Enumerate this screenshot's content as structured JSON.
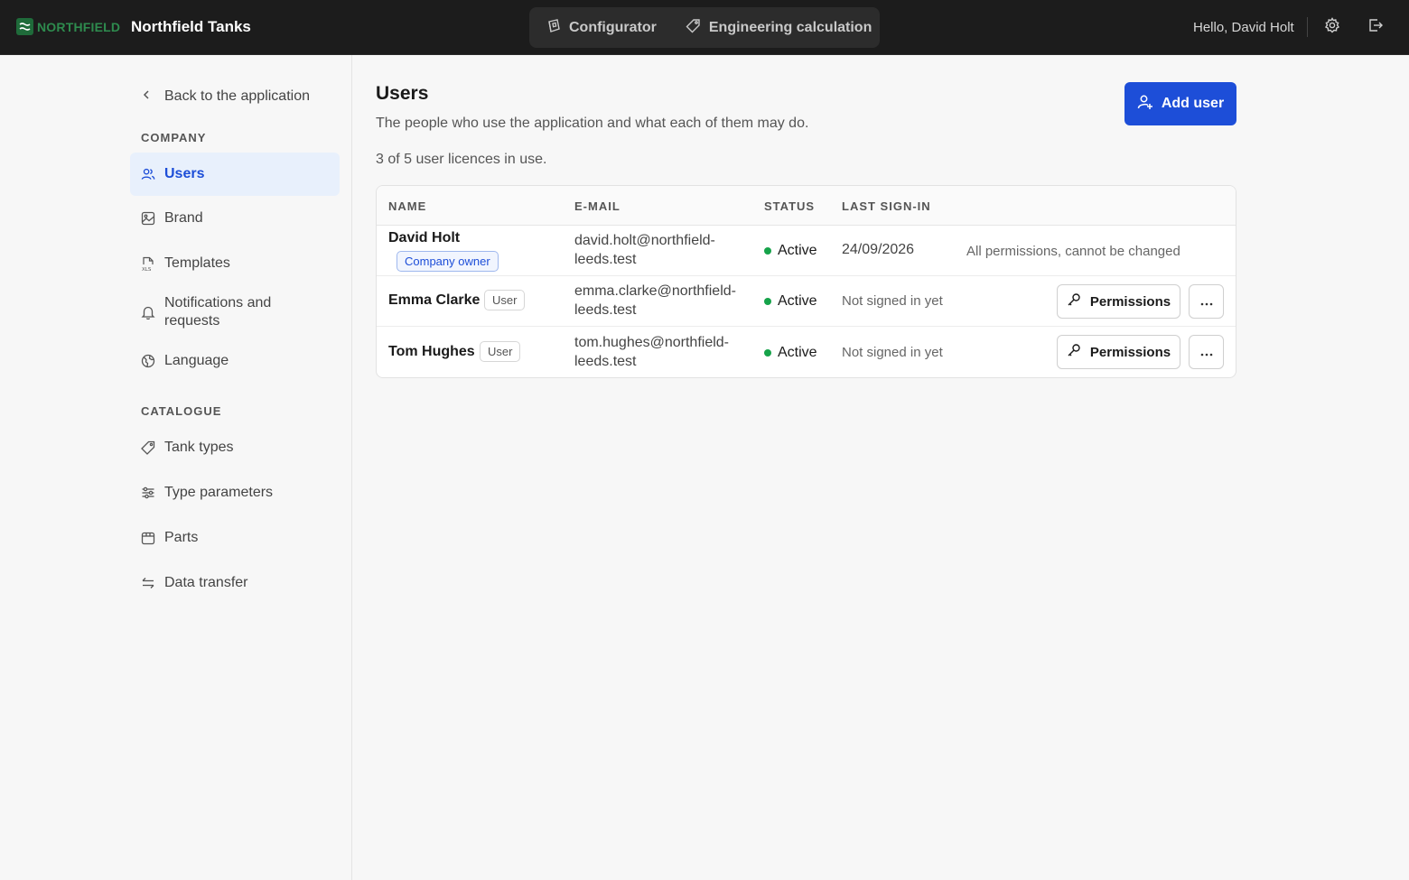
{
  "topbar": {
    "logo_text": "NORTHFIELD",
    "app_name": "Northfield Tanks",
    "modes": [
      {
        "label": "Configurator",
        "icon": "cube-icon"
      },
      {
        "label": "Engineering calculation",
        "icon": "tag-icon"
      }
    ],
    "greeting": "Hello, David Holt",
    "settings_icon": "gear-icon",
    "logout_icon": "logout-icon",
    "accent": "#2e8b4e"
  },
  "sidebar": {
    "back_label": "Back to the application",
    "sections": [
      {
        "title": "COMPANY",
        "items": [
          {
            "label": "Users",
            "icon": "users-icon",
            "active": true
          },
          {
            "label": "Brand",
            "icon": "image-icon"
          },
          {
            "label": "Templates",
            "icon": "xls-file-icon"
          },
          {
            "label": "Notifications and requests",
            "icon": "bell-icon"
          },
          {
            "label": "Language",
            "icon": "globe-icon"
          }
        ]
      },
      {
        "title": "CATALOGUE",
        "items": [
          {
            "label": "Tank types",
            "icon": "tag-icon"
          },
          {
            "label": "Type parameters",
            "icon": "sliders-icon"
          },
          {
            "label": "Parts",
            "icon": "box-icon"
          },
          {
            "label": "Data transfer",
            "icon": "transfer-icon"
          }
        ]
      }
    ]
  },
  "main": {
    "title": "Users",
    "subtitle": "The people who use the application and what each of them may do.",
    "licences": "3 of 5 user licences in use.",
    "add_button": "Add user",
    "primary_color": "#1d4ed8",
    "table": {
      "headers": [
        "NAME",
        "E-MAIL",
        "STATUS",
        "LAST SIGN-IN"
      ],
      "rows": [
        {
          "name": "David Holt",
          "role": "Company owner",
          "email_line1": "david.holt@northfield-",
          "email_line2": "leeds.test",
          "status": "Active",
          "last_sign_in": "24/09/2026",
          "permissions_note": "All permissions, cannot be changed"
        },
        {
          "name": "Emma Clarke",
          "role": "User",
          "email_line1": "emma.clarke@northfield-",
          "email_line2": "leeds.test",
          "status": "Active",
          "last_sign_in": "Not signed in yet",
          "permissions_button": "Permissions"
        },
        {
          "name": "Tom Hughes",
          "role": "User",
          "email_line1": "tom.hughes@northfield-",
          "email_line2": "leeds.test",
          "status": "Active",
          "last_sign_in": "Not signed in yet",
          "permissions_button": "Permissions"
        }
      ]
    }
  }
}
